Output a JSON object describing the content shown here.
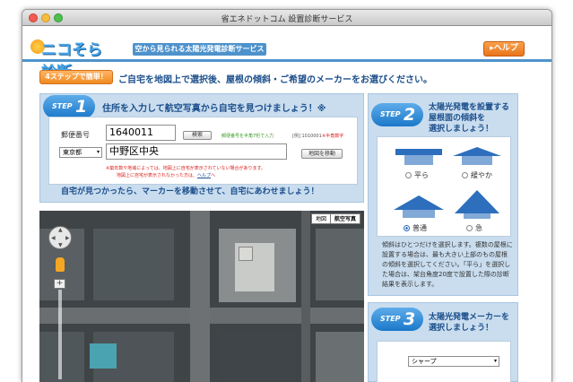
{
  "window": {
    "title": "省エネドットコム 設置診断サービス"
  },
  "header": {
    "logo_text": "ニコそら診断",
    "tagline": "空から見られる太陽光発電診断サービス",
    "help_label": "ヘルプ"
  },
  "intro": {
    "badge": "4ステップで簡単！",
    "instruction": "ご自宅を地図上で選択後、屋根の傾斜・ご希望のメーカーをお選びください。"
  },
  "step1": {
    "word": "STEP",
    "number": "1",
    "title": "住所を入力して航空写真から自宅を見つけましょう！※",
    "postal_label": "郵便番号",
    "postal_value": "1640011",
    "search_button": "検索",
    "postal_hint": "郵便番号を半角7桁で入力",
    "postal_example": "[例] 1010001",
    "half_width_note": "※半角数字",
    "prefecture": "東京都",
    "address_value": "中野区中央",
    "move_button": "地図を移動",
    "note_line1": "※築年数や地域によっては、地図上に自宅が表示されていない場合があります。",
    "note_line2a": "地図上に自宅が表示されなかった方は、",
    "note_help_link": "ヘルプ",
    "note_line2b": "へ",
    "footer_text": "自宅が見つかったら、マーカーを移動させて、自宅にあわせましょう！"
  },
  "map": {
    "type_map": "地図",
    "type_aerial": "航空写真"
  },
  "step2": {
    "word": "STEP",
    "number": "2",
    "title_line1": "太陽光発電を設置する",
    "title_line2": "屋根面の傾斜を",
    "title_line3": "選択しましょう！",
    "options": [
      {
        "label": "平ら",
        "selected": false
      },
      {
        "label": "緩やか",
        "selected": false
      },
      {
        "label": "普通",
        "selected": true
      },
      {
        "label": "急",
        "selected": false
      }
    ],
    "description": "傾斜はひとつだけを選択します。複数の屋根に設置する場合は、最も大きい上部のもの屋根の傾斜を選択してください。「平ら」を選択した場合は、架台角度20度で設置した際の診断結果を表示します。"
  },
  "step3": {
    "word": "STEP",
    "number": "3",
    "title_line1": "太陽光発電メーカーを",
    "title_line2": "選択しましょう！",
    "manufacturer": "シャープ"
  },
  "colors": {
    "accent_blue": "#1b4e8b",
    "panel_bg": "#c9ddef",
    "orange": "#f08a22"
  }
}
